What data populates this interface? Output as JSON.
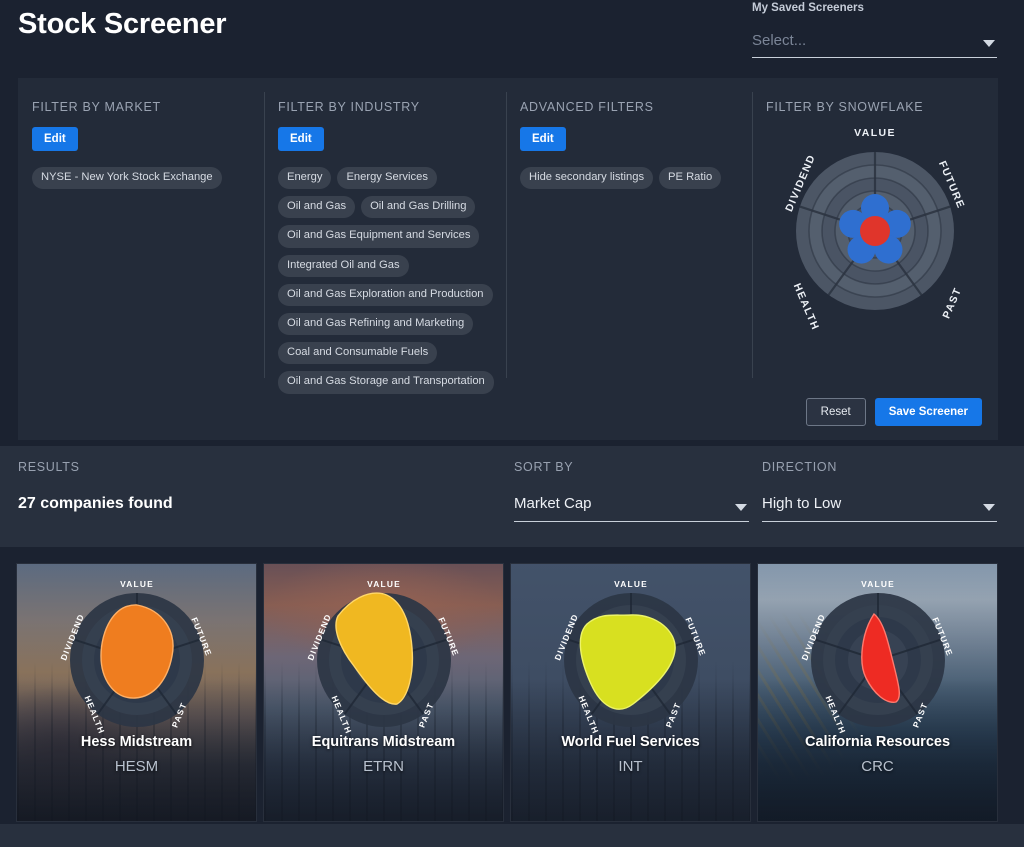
{
  "header": {
    "title": "Stock Screener",
    "saved_screeners": {
      "label": "My Saved Screeners",
      "value": "Select...",
      "caret_icon": "chevron-down-icon"
    }
  },
  "filters": {
    "market": {
      "title": "FILTER BY MARKET",
      "edit_label": "Edit",
      "chips": [
        "NYSE - New York Stock Exchange"
      ]
    },
    "industry": {
      "title": "FILTER BY INDUSTRY",
      "edit_label": "Edit",
      "chips": [
        "Energy",
        "Energy Services",
        "Oil and Gas",
        "Oil and Gas Drilling",
        "Oil and Gas Equipment and Services",
        "Integrated Oil and Gas",
        "Oil and Gas Exploration and Production",
        "Oil and Gas Refining and Marketing",
        "Coal and Consumable Fuels",
        "Oil and Gas Storage and Transportation"
      ]
    },
    "advanced": {
      "title": "ADVANCED FILTERS",
      "edit_label": "Edit",
      "chips": [
        "Hide secondary listings",
        "PE Ratio"
      ]
    },
    "snowflake": {
      "title": "FILTER BY SNOWFLAKE",
      "axes": [
        "VALUE",
        "FUTURE",
        "PAST",
        "HEALTH",
        "DIVIDEND"
      ],
      "handle_color": "#2f6fd0",
      "center_color": "#e0352b"
    },
    "actions": {
      "reset_label": "Reset",
      "save_label": "Save Screener"
    }
  },
  "results_bar": {
    "results_label": "RESULTS",
    "count_text": "27 companies found",
    "sort_by": {
      "label": "SORT BY",
      "value": "Market Cap",
      "caret_icon": "chevron-down-icon"
    },
    "direction": {
      "label": "DIRECTION",
      "value": "High to Low",
      "caret_icon": "chevron-down-icon"
    }
  },
  "cards": [
    {
      "name": "Hess Midstream",
      "ticker": "HESM",
      "snowflake_color": "#ef7d1f",
      "snowflake_shape": "value-future-heavy"
    },
    {
      "name": "Equitrans Midstream",
      "ticker": "ETRN",
      "snowflake_color": "#f0b821",
      "snowflake_shape": "value-dividend-heavy"
    },
    {
      "name": "World Fuel Services",
      "ticker": "INT",
      "snowflake_color": "#d8e020",
      "snowflake_shape": "dividend-health-heavy"
    },
    {
      "name": "California Resources",
      "ticker": "CRC",
      "snowflake_color": "#ee2b23",
      "snowflake_shape": "value-past-narrow"
    }
  ],
  "colors": {
    "page_bg": "#1b2230",
    "panel_bg": "#232b39",
    "results_bg": "#28303e",
    "accent_blue": "#1677e8",
    "chip_bg": "#39414e"
  }
}
